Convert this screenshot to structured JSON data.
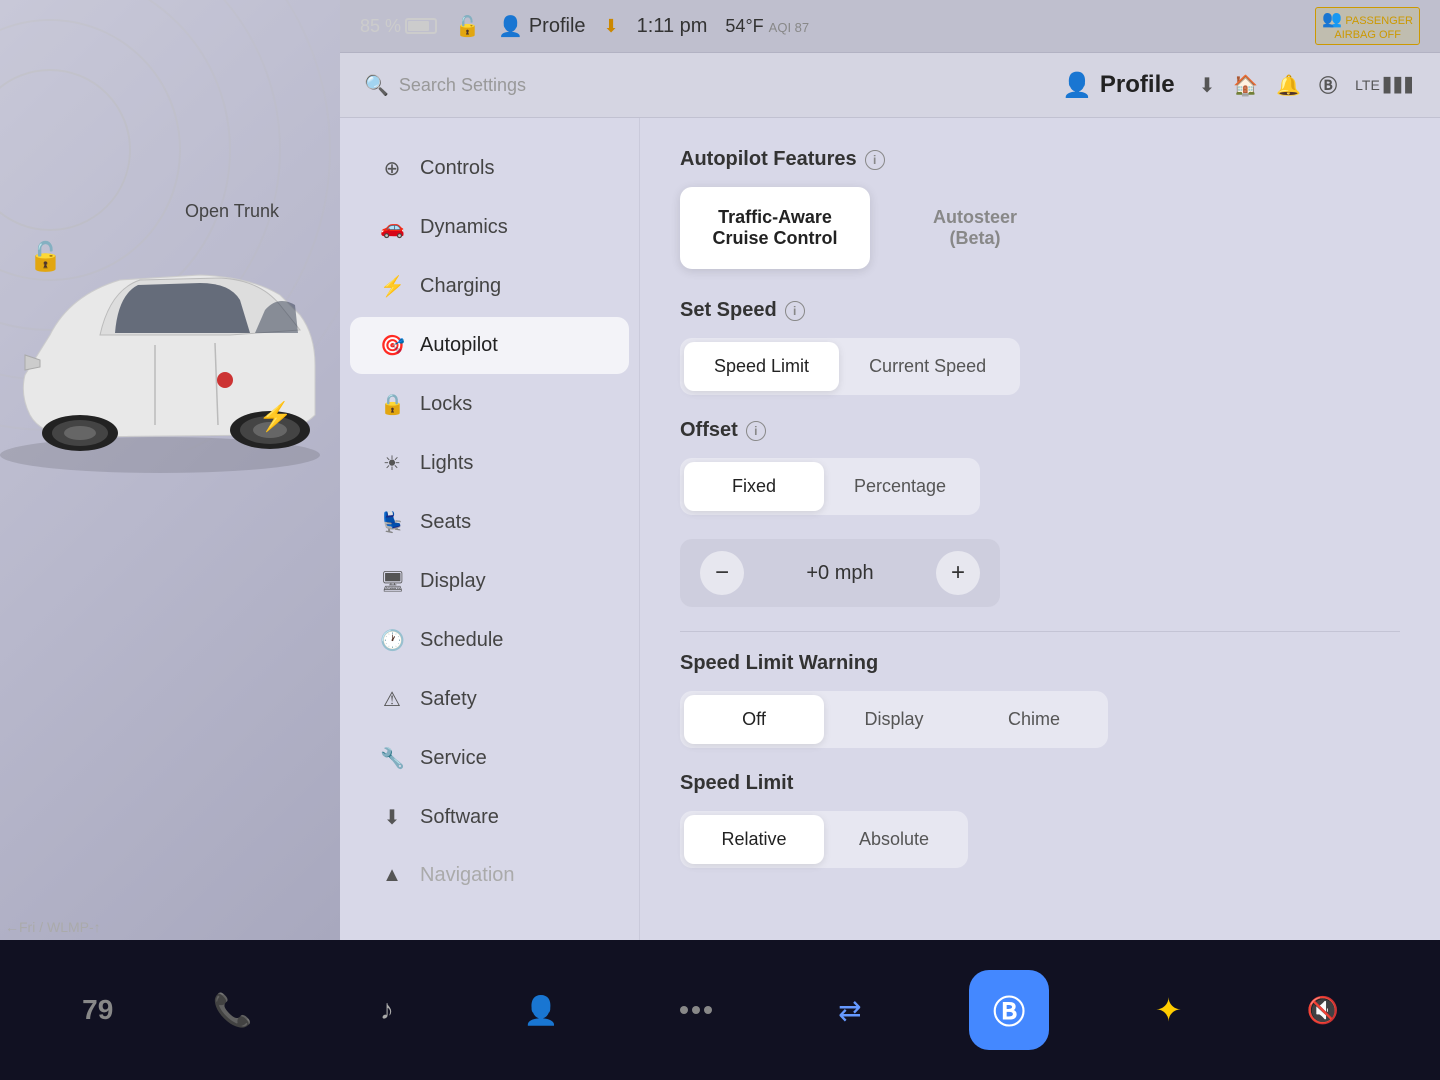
{
  "topBar": {
    "batteryPercent": "85 %",
    "profileLabel": "Profile",
    "downloadIcon": "⬇",
    "time": "1:11 pm",
    "temperature": "54°F",
    "aqiLabel": "AQI",
    "aqiValue": "87",
    "passengerAirbag": "PASSENGER\nAIRBAG OFF"
  },
  "searchBar": {
    "placeholder": "Search Settings",
    "profileLabel": "Profile"
  },
  "icons": {
    "download": "⬇",
    "garage": "🏠",
    "bell": "🔔",
    "bluetooth": "Ⓑ",
    "lte": "LTE",
    "signal": "▋▋▋"
  },
  "nav": {
    "items": [
      {
        "id": "controls",
        "label": "Controls",
        "icon": "⊕"
      },
      {
        "id": "dynamics",
        "label": "Dynamics",
        "icon": "🚗"
      },
      {
        "id": "charging",
        "label": "Charging",
        "icon": "⚡"
      },
      {
        "id": "autopilot",
        "label": "Autopilot",
        "icon": "🎯",
        "active": true
      },
      {
        "id": "locks",
        "label": "Locks",
        "icon": "🔒"
      },
      {
        "id": "lights",
        "label": "Lights",
        "icon": "☀"
      },
      {
        "id": "seats",
        "label": "Seats",
        "icon": "💺"
      },
      {
        "id": "display",
        "label": "Display",
        "icon": "🖥"
      },
      {
        "id": "schedule",
        "label": "Schedule",
        "icon": "🕐"
      },
      {
        "id": "safety",
        "label": "Safety",
        "icon": "⚠"
      },
      {
        "id": "service",
        "label": "Service",
        "icon": "🔧"
      },
      {
        "id": "software",
        "label": "Software",
        "icon": "⬇"
      },
      {
        "id": "navigation",
        "label": "Navigation",
        "icon": "▲",
        "dimmed": true
      }
    ]
  },
  "autopilot": {
    "sectionTitle": "Autopilot Features",
    "cruiseControl": {
      "label1": "Traffic-Aware",
      "label2": "Cruise Control",
      "active": true
    },
    "autosteer": {
      "label1": "Autosteer",
      "label2": "(Beta)",
      "active": false
    },
    "setSpeed": {
      "title": "Set Speed",
      "speedLimit": "Speed Limit",
      "currentSpeed": "Current Speed",
      "activeOption": "speedLimit"
    },
    "offset": {
      "title": "Offset",
      "fixed": "Fixed",
      "percentage": "Percentage",
      "activeOption": "fixed"
    },
    "speedValue": "+0 mph",
    "minus": "−",
    "plus": "+",
    "speedLimitWarning": {
      "title": "Speed Limit Warning",
      "off": "Off",
      "display": "Display",
      "chime": "Chime",
      "activeOption": "off"
    },
    "speedLimit": {
      "title": "Speed Limit",
      "relative": "Relative",
      "absolute": "Absolute"
    }
  },
  "vehicle": {
    "openTrunk": "Open\nTrunk"
  },
  "taskbar": {
    "items": [
      {
        "id": "phone",
        "icon": "📞",
        "color": "green"
      },
      {
        "id": "music",
        "icon": "♪",
        "color": "normal"
      },
      {
        "id": "camera",
        "icon": "👤",
        "color": "normal"
      },
      {
        "id": "dots",
        "icon": "•••",
        "color": "normal"
      },
      {
        "id": "center",
        "icon": "✕",
        "color": "blue"
      },
      {
        "id": "bluetooth",
        "icon": "⬡",
        "color": "blue"
      },
      {
        "id": "games",
        "icon": "✦",
        "color": "yellow"
      },
      {
        "id": "volume",
        "icon": "🔇",
        "color": "normal"
      }
    ]
  },
  "bottomInfo": "←Fri / WLMP-↑",
  "pageNumber": "79"
}
